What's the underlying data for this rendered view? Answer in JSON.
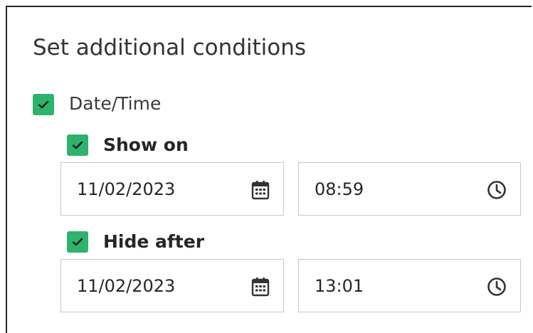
{
  "panel": {
    "title": "Set additional conditions"
  },
  "date_time": {
    "label": "Date/Time",
    "checked": true
  },
  "show_on": {
    "label": "Show on",
    "checked": true,
    "date": "11/02/2023",
    "time": "08:59"
  },
  "hide_after": {
    "label": "Hide after",
    "checked": true,
    "date": "11/02/2023",
    "time": "13:01"
  },
  "icons": {
    "date": "calendar-icon",
    "time": "clock-icon",
    "check": "checkmark-icon"
  },
  "colors": {
    "checkbox": "#2db36b",
    "border": "#c8c8c8",
    "text": "#262626"
  }
}
